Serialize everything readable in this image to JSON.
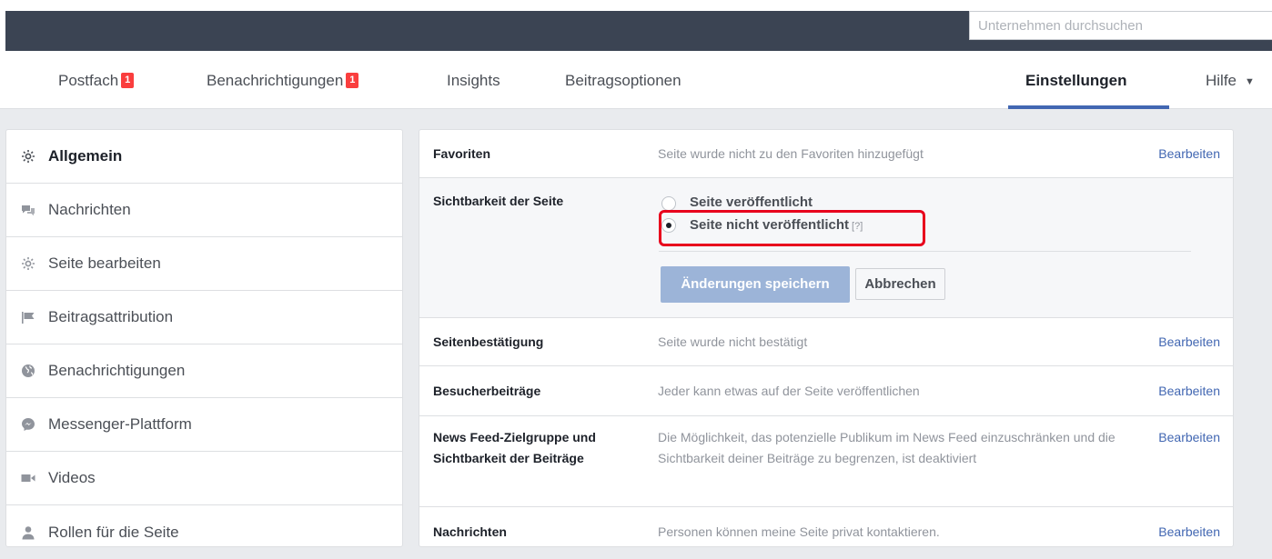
{
  "search": {
    "placeholder": "Unternehmen durchsuchen"
  },
  "tabs": [
    {
      "label": "Postfach",
      "badge": "1"
    },
    {
      "label": "Benachrichtigungen",
      "badge": "1"
    },
    {
      "label": "Insights"
    },
    {
      "label": "Beitragsoptionen"
    },
    {
      "label": "Einstellungen",
      "active": true
    },
    {
      "label": "Hilfe",
      "dropdown_glyph": "▼"
    }
  ],
  "sidebar": {
    "items": [
      {
        "label": "Allgemein",
        "icon": "gear-icon",
        "active": true
      },
      {
        "label": "Nachrichten",
        "icon": "chat-bubbles-icon"
      },
      {
        "label": "Seite bearbeiten",
        "icon": "gear-icon"
      },
      {
        "label": "Beitragsattribution",
        "icon": "flag-icon"
      },
      {
        "label": "Benachrichtigungen",
        "icon": "globe-icon"
      },
      {
        "label": "Messenger-Plattform",
        "icon": "messenger-icon"
      },
      {
        "label": "Videos",
        "icon": "video-camera-icon"
      },
      {
        "label": "Rollen für die Seite",
        "icon": "person-icon"
      }
    ]
  },
  "settings": {
    "edit_label": "Bearbeiten",
    "favorites": {
      "label": "Favoriten",
      "value": "Seite wurde nicht zu den Favoriten hinzugefügt"
    },
    "visibility": {
      "label": "Sichtbarkeit der Seite",
      "option_published": "Seite veröffentlicht",
      "option_unpublished": "Seite nicht veröffentlicht",
      "help": "[?]",
      "save_label": "Änderungen speichern",
      "cancel_label": "Abbrechen"
    },
    "verification": {
      "label": "Seitenbestätigung",
      "value": "Seite wurde nicht bestätigt"
    },
    "visitor_posts": {
      "label": "Besucherbeiträge",
      "value": "Jeder kann etwas auf der Seite veröffentlichen"
    },
    "newsfeed": {
      "label_line1": "News Feed-Zielgruppe und",
      "label_line2": "Sichtbarkeit der Beiträge",
      "value": "Die Möglichkeit, das potenzielle Publikum im News Feed einzuschränken und die Sichtbarkeit deiner Beiträge zu begrenzen, ist deaktiviert"
    },
    "messages": {
      "label": "Nachrichten",
      "value": "Personen können meine Seite privat kontaktieren."
    }
  },
  "colors": {
    "topbar": "#3b4453",
    "accent": "#4267b2",
    "badge": "#fa3e3e",
    "highlight": "#e8001c"
  }
}
